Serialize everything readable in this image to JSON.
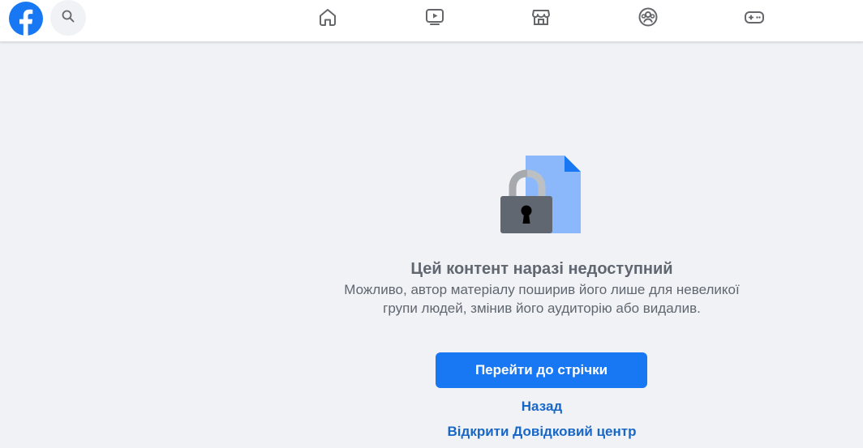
{
  "header": {
    "logo": "facebook-logo",
    "search_icon": "search-icon",
    "nav": [
      {
        "icon": "home-icon"
      },
      {
        "icon": "video-icon"
      },
      {
        "icon": "marketplace-icon"
      },
      {
        "icon": "groups-icon"
      },
      {
        "icon": "gaming-icon"
      }
    ]
  },
  "main": {
    "illustration": "locked-document-icon",
    "title": "Цей контент наразі недоступний",
    "description": "Можливо, автор матеріалу поширив його лише для невеликої групи людей, змінив його аудиторію або видалив.",
    "primary_button": "Перейти до стрічки",
    "back_link": "Назад",
    "help_link": "Відкрити Довідковий центр"
  },
  "colors": {
    "brand": "#1877f2",
    "background": "#f0f2f5",
    "text_secondary": "#606770",
    "link": "#1867c7",
    "icon": "#65676b"
  }
}
